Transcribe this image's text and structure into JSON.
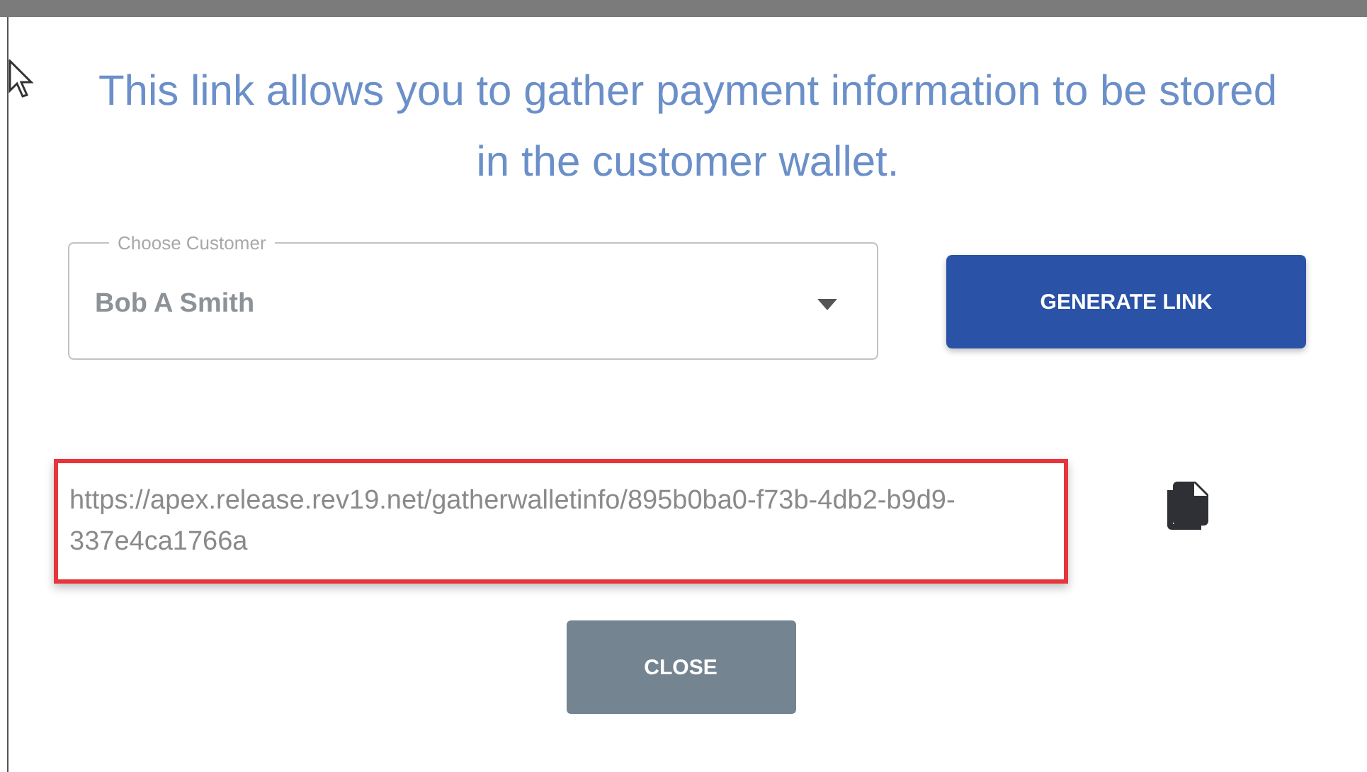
{
  "dialog": {
    "message": "This link allows you to gather payment information to be stored in the customer wallet.",
    "customer_select": {
      "label": "Choose Customer",
      "value": "Bob A Smith"
    },
    "generate_button": "GENERATE LINK",
    "link": {
      "url": "https://apex.release.rev19.net/gatherwalletinfo/895b0ba0-f73b-4db2-b9d9-337e4ca1766a",
      "highlighted": true
    },
    "close_button": "CLOSE"
  }
}
